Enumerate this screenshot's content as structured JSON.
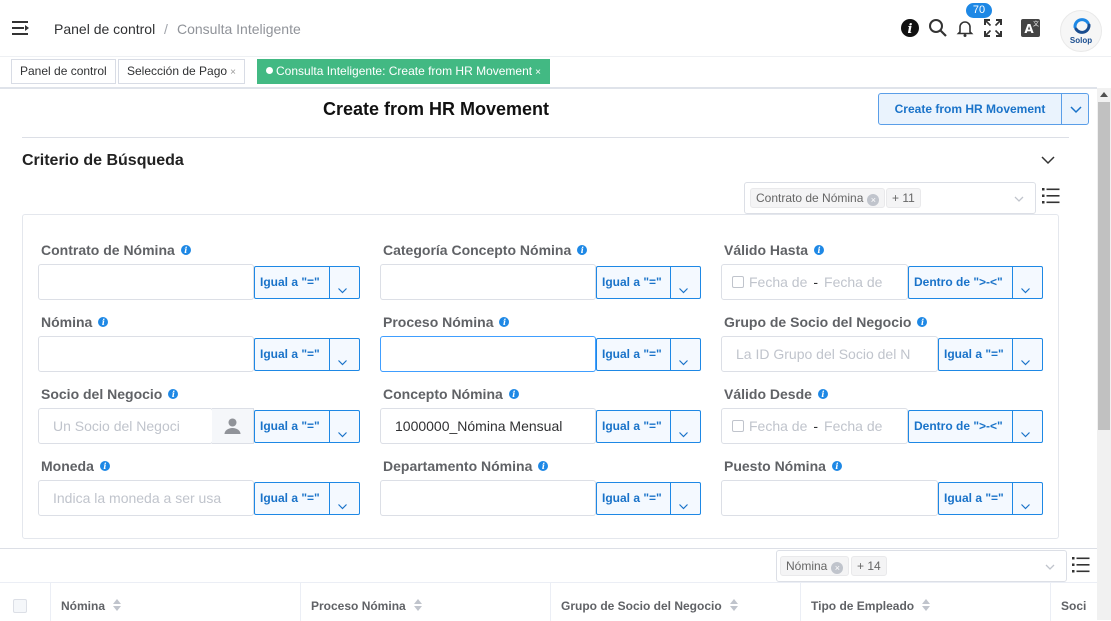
{
  "header": {
    "breadcrumb_home": "Panel de control",
    "breadcrumb_sep": "/",
    "breadcrumb_current": "Consulta Inteligente",
    "notification_count": "70",
    "logo_text": "Solop"
  },
  "tabs": [
    {
      "label": "Panel de control",
      "closable": false,
      "active": false
    },
    {
      "label": "Selección de Pago",
      "closable": true,
      "active": false
    },
    {
      "label": "Consulta Inteligente: Create from HR Movement",
      "closable": true,
      "active": true
    }
  ],
  "tab_close_glyph": "×",
  "page": {
    "title": "Create from HR Movement",
    "action_button": "Create from HR Movement"
  },
  "search": {
    "section_title": "Criterio de Búsqueda",
    "selected_fields_chip": "Contrato de Nómina",
    "selected_fields_more": "+ 11",
    "fields": {
      "contrato": {
        "label": "Contrato de Nómina",
        "value": "",
        "operator": "Igual a \"=\""
      },
      "categoria": {
        "label": "Categoría Concepto Nómina",
        "value": "",
        "operator": "Igual a \"=\""
      },
      "valido_hasta": {
        "label": "Válido Hasta",
        "from_placeholder": "Fecha de",
        "to_placeholder": "Fecha de",
        "separator": "-",
        "operator": "Dentro de \">-<\""
      },
      "nomina": {
        "label": "Nómina",
        "value": "",
        "operator": "Igual a \"=\""
      },
      "proceso": {
        "label": "Proceso Nómina",
        "value": "",
        "operator": "Igual a \"=\""
      },
      "grupo_socio": {
        "label": "Grupo de Socio del Negocio",
        "placeholder": "La ID Grupo del Socio del N",
        "operator": "Igual a \"=\""
      },
      "socio": {
        "label": "Socio del Negocio",
        "placeholder": "Un Socio del Negoci",
        "operator": "Igual a \"=\""
      },
      "concepto": {
        "label": "Concepto Nómina",
        "value": "1000000_Nómina Mensual",
        "operator": "Igual a \"=\""
      },
      "valido_desde": {
        "label": "Válido Desde",
        "from_placeholder": "Fecha de",
        "to_placeholder": "Fecha de",
        "separator": "-",
        "operator": "Dentro de \">-<\""
      },
      "moneda": {
        "label": "Moneda",
        "placeholder": "Indica la moneda a ser usa",
        "operator": "Igual a \"=\""
      },
      "departamento": {
        "label": "Departamento Nómina",
        "value": "",
        "operator": "Igual a \"=\""
      },
      "puesto": {
        "label": "Puesto Nómina",
        "value": "",
        "operator": "Igual a \"=\""
      }
    }
  },
  "table": {
    "column_chip": "Nómina",
    "column_more": "+ 14",
    "columns": [
      "Nómina",
      "Proceso Nómina",
      "Grupo de Socio del Negocio",
      "Tipo de Empleado",
      "Soci"
    ]
  },
  "colors": {
    "accent": "#1e88e5",
    "active_tab": "#42b983",
    "info_icon": "#1e88e5"
  }
}
